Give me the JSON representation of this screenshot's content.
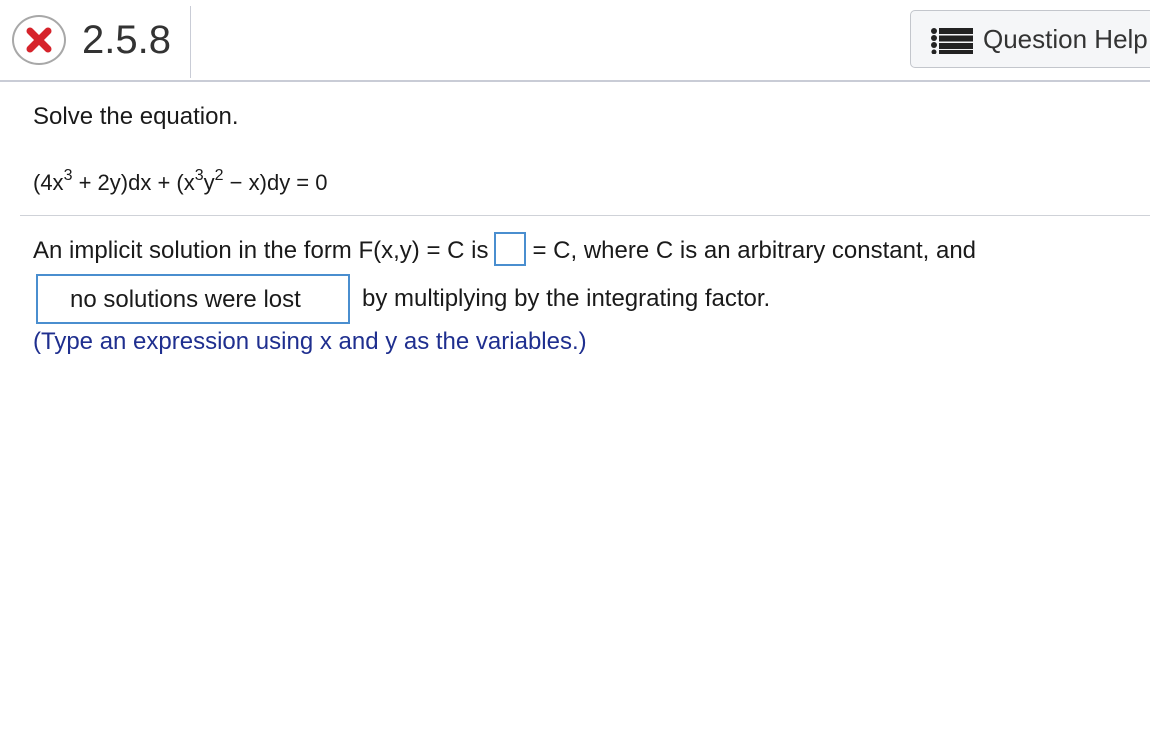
{
  "header": {
    "question_number": "2.5.8",
    "help_label": "Question Help",
    "status_icon": "x-circle-icon",
    "status_color": "#d6232b"
  },
  "question": {
    "prompt": "Solve the equation.",
    "equation": {
      "t1": "(4x",
      "s1": "3",
      "t2": " + 2y)dx + (x",
      "s2": "3",
      "t3": "y",
      "s3": "2",
      "t4": " − x)dy = 0"
    },
    "line1_before": "An implicit solution in the form F(x,y) = C is",
    "answer_value": "",
    "line1_after": "= C, where C is an arbitrary constant, and",
    "dropdown_selected": "no solutions were lost",
    "line2_after": "by multiplying by the integrating factor.",
    "hint": "(Type an expression using x and y as the variables.)"
  }
}
